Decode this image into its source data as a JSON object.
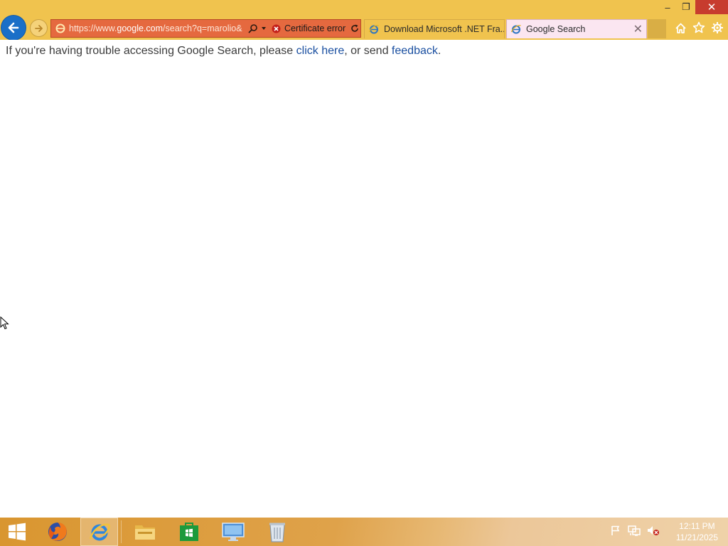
{
  "window": {
    "minimize_glyph": "–",
    "restore_glyph": "❐",
    "close_glyph": "✕"
  },
  "address_bar": {
    "url_prefix": "https://www.",
    "url_domain": "google.com",
    "url_suffix": "/search?q=marolio&",
    "certificate_label": "Certificate error"
  },
  "tabs": [
    {
      "title": "Download Microsoft .NET Fra...",
      "icon": "ie-icon",
      "active": false
    },
    {
      "title": "Google Search",
      "icon": "ie-icon",
      "active": true,
      "close_glyph": "✕"
    }
  ],
  "toolbar_icons": [
    "home-icon",
    "favorites-star-icon",
    "settings-gear-icon"
  ],
  "page": {
    "message_before": "If you're having trouble accessing Google Search, please ",
    "link_click_here": "click here",
    "message_middle": ", or send ",
    "link_feedback": "feedback",
    "message_end": "."
  },
  "taskbar": {
    "pinned": [
      "start-button",
      "firefox",
      "internet-explorer",
      "file-explorer",
      "windows-store",
      "remote-desktop",
      "recycle-bin"
    ],
    "tray_icons": [
      "action-center-flag-icon",
      "network-icon",
      "volume-muted-icon"
    ],
    "clock": {
      "time": "12:11 PM",
      "date": "11/21/2025"
    }
  },
  "colors": {
    "frame": "#f0c34e",
    "address_bar_error": "#e5693f",
    "back_button": "#1a6fc8",
    "active_tab": "#fbe6f1",
    "link": "#1a4fa0",
    "taskbar": "#d99630"
  }
}
